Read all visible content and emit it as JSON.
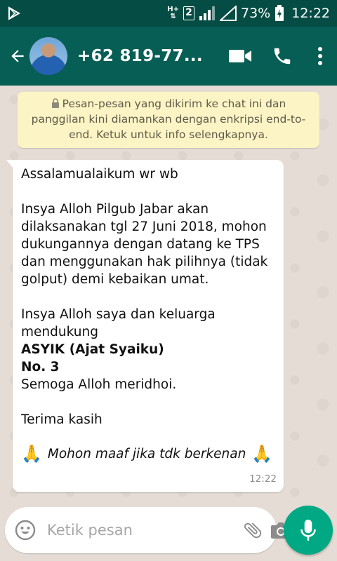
{
  "status_bar": {
    "network_type": "H+",
    "sim_slot": "2",
    "battery_percent": "73%",
    "time": "12:22"
  },
  "header": {
    "contact_name": "+62 819-77...",
    "icons": [
      "back-arrow-icon",
      "video-call-icon",
      "phone-icon",
      "more-vert-icon"
    ]
  },
  "encryption_notice": {
    "text": "Pesan-pesan yang dikirim ke chat ini dan panggilan kini diamankan dengan enkripsi end-to-end. Ketuk untuk info selengkapnya."
  },
  "message": {
    "greeting": "Assalamualaikum wr wb",
    "paragraph1": "Insya Alloh Pilgub Jabar akan dilaksanakan tgl 27 Juni 2018, mohon dukungannya dengan datang ke TPS dan menggunakan hak pilihnya (tidak golput) demi kebaikan umat.",
    "paragraph2": "Insya Alloh saya dan keluarga mendukung",
    "candidate": "ASYIK (Ajat Syaiku)",
    "number": "No. 3",
    "blessing": "Semoga Alloh meridhoi.",
    "thanks": "Terima kasih",
    "closing": "Mohon maaf jika tdk berkenan",
    "emoji": "🙏",
    "time": "12:22"
  },
  "input": {
    "placeholder": "Ketik pesan"
  },
  "colors": {
    "header": "#075e54",
    "status_bar": "#054d44",
    "chat_background": "#e5ddd5",
    "notice_background": "#fcf4c4",
    "mic_button": "#00a884"
  }
}
